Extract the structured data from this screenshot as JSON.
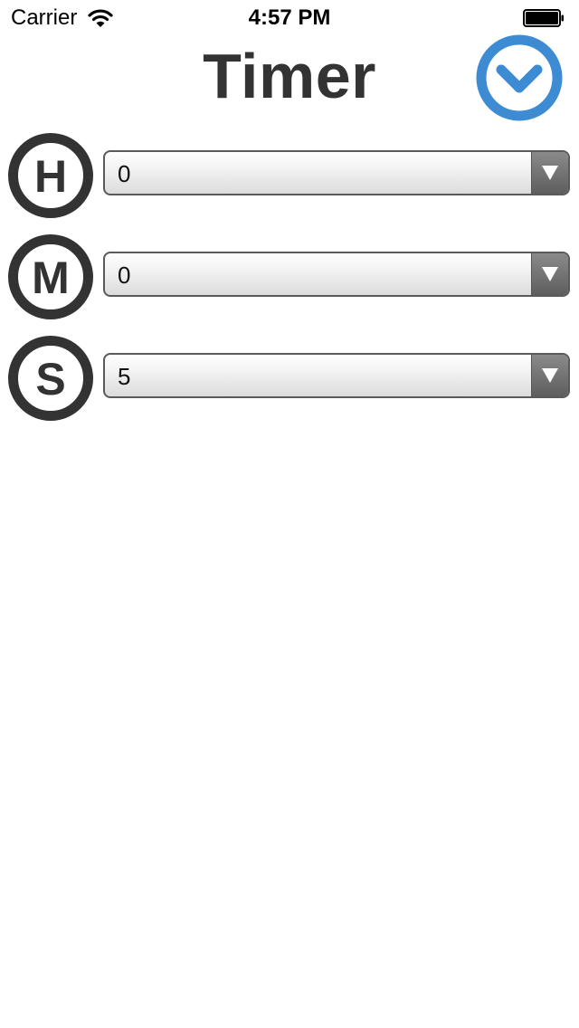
{
  "status_bar": {
    "carrier": "Carrier",
    "time": "4:57 PM",
    "icons": [
      "wifi-icon",
      "battery-icon"
    ]
  },
  "header": {
    "title": "Timer",
    "action_icon": "chevron-down-circle-icon",
    "accent_color": "#3d8bd3"
  },
  "fields": [
    {
      "letter": "H",
      "icon": "hours-icon",
      "value": "0"
    },
    {
      "letter": "M",
      "icon": "minutes-icon",
      "value": "0"
    },
    {
      "letter": "S",
      "icon": "seconds-icon",
      "value": "5"
    }
  ],
  "colors": {
    "icon_ring": "#333333",
    "select_arrow": "#6b6b6b"
  }
}
